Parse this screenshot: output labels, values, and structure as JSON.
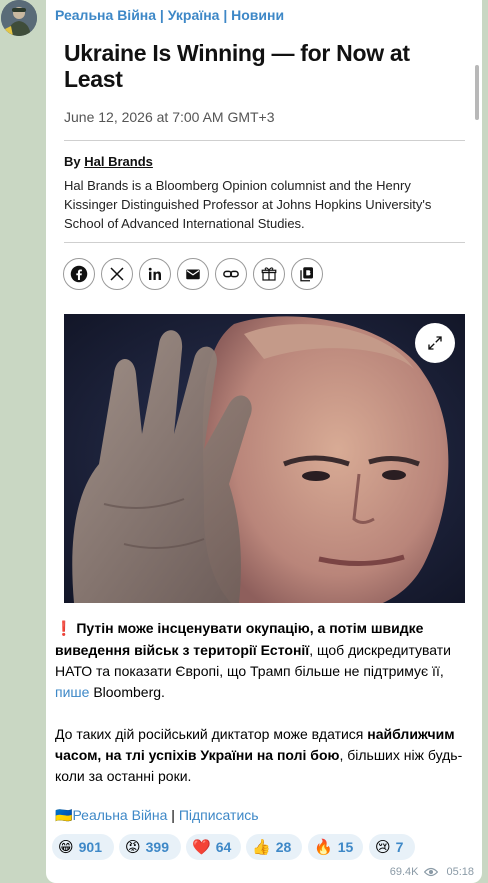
{
  "channel": {
    "name": "Реальна Війна | Україна | Новини",
    "avatar": "channel-avatar"
  },
  "article": {
    "title": "Ukraine Is Winning — for Now at Least",
    "date": "June 12, 2026 at 7:00 AM GMT+3",
    "by_prefix": "By",
    "author": "Hal Brands",
    "bio": "Hal Brands is a Bloomberg Opinion columnist and the Henry Kissinger Distinguished Professor at Johns Hopkins University's School of Advanced International Studies.",
    "share_buttons": [
      {
        "icon": "facebook-icon"
      },
      {
        "icon": "x-icon"
      },
      {
        "icon": "linkedin-icon"
      },
      {
        "icon": "email-icon"
      },
      {
        "icon": "link-icon"
      },
      {
        "icon": "gift-icon"
      },
      {
        "icon": "bookmark-icon"
      }
    ],
    "expand_icon": "expand-icon"
  },
  "message": {
    "p1_emoji": "❗",
    "p1_bold": "Путін може інсценувати окупацію, а потім швидке виведення військ з території Естонії",
    "p1_text": ", щоб дискредитувати НАТО та показати Європі, що Трамп більше не підтримує її,",
    "p1_link": "пише",
    "p1_end": "Bloomberg.",
    "p2_start": "До таких дій російський диктатор може вдатися ",
    "p2_bold": "найближчим часом, на тлі успіхів України на полі бою",
    "p2_end": ", більших ніж будь-коли за останні роки."
  },
  "signature": {
    "flag": "🇺🇦",
    "channel_link": "Реальна Війна",
    "separator": "|",
    "subscribe_link": "Підписатись"
  },
  "reactions": [
    {
      "emoji": "😁",
      "count": "901"
    },
    {
      "emoji": "😡",
      "count": "399"
    },
    {
      "emoji": "❤️",
      "count": "64"
    },
    {
      "emoji": "👍",
      "count": "28"
    },
    {
      "emoji": "🔥",
      "count": "15"
    },
    {
      "emoji": "😢",
      "count": "7"
    }
  ],
  "meta": {
    "views": "69.4K",
    "time": "05:18"
  },
  "colors": {
    "accent": "#3e88c7",
    "background": "#c9d7c3",
    "bubble": "#ffffff",
    "reaction_bg": "#e8f1f8"
  }
}
